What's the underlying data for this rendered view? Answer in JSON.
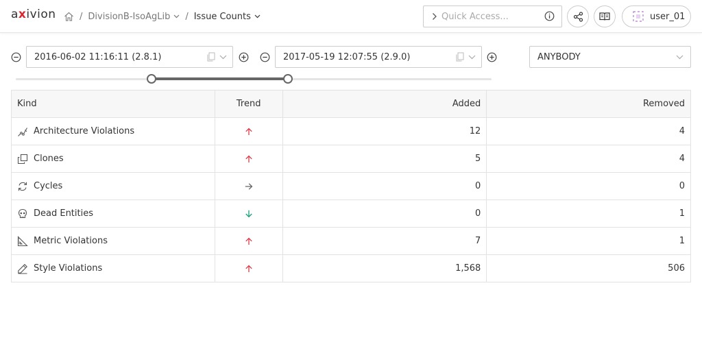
{
  "header": {
    "logo_prefix": "a",
    "logo_x": "x",
    "logo_suffix": "ivion",
    "separator": "/",
    "project": "DivisionB-IsoAgLib",
    "page": "Issue Counts",
    "quick_access_placeholder": "Quick Access...",
    "user": "user_01",
    "icons": {
      "home": "home-icon",
      "share": "share-icon",
      "docs": "book-icon",
      "info": "info-icon",
      "avatar": "avatar-icon"
    }
  },
  "filters": {
    "start_version": "2016-06-02 11:16:11 (2.8.1)",
    "end_version": "2017-05-19 12:07:55 (2.9.0)",
    "user_filter": "ANYBODY",
    "range_start_fraction": 0.285,
    "range_end_fraction": 0.572
  },
  "table": {
    "columns": [
      "Kind",
      "Trend",
      "Added",
      "Removed"
    ],
    "rows": [
      {
        "kind": "Architecture Violations",
        "icon": "architecture-icon",
        "trend": "up",
        "added": "12",
        "removed": "4"
      },
      {
        "kind": "Clones",
        "icon": "clones-icon",
        "trend": "up",
        "added": "5",
        "removed": "4"
      },
      {
        "kind": "Cycles",
        "icon": "cycles-icon",
        "trend": "flat",
        "added": "0",
        "removed": "0"
      },
      {
        "kind": "Dead Entities",
        "icon": "skull-icon",
        "trend": "down",
        "added": "0",
        "removed": "1"
      },
      {
        "kind": "Metric Violations",
        "icon": "metric-icon",
        "trend": "up",
        "added": "7",
        "removed": "1"
      },
      {
        "kind": "Style Violations",
        "icon": "style-icon",
        "trend": "up",
        "added": "1,568",
        "removed": "506"
      }
    ]
  },
  "colors": {
    "trend_up": "#e23a48",
    "trend_down": "#16a07a",
    "trend_flat": "#666666",
    "brand_red": "#d9272e"
  }
}
